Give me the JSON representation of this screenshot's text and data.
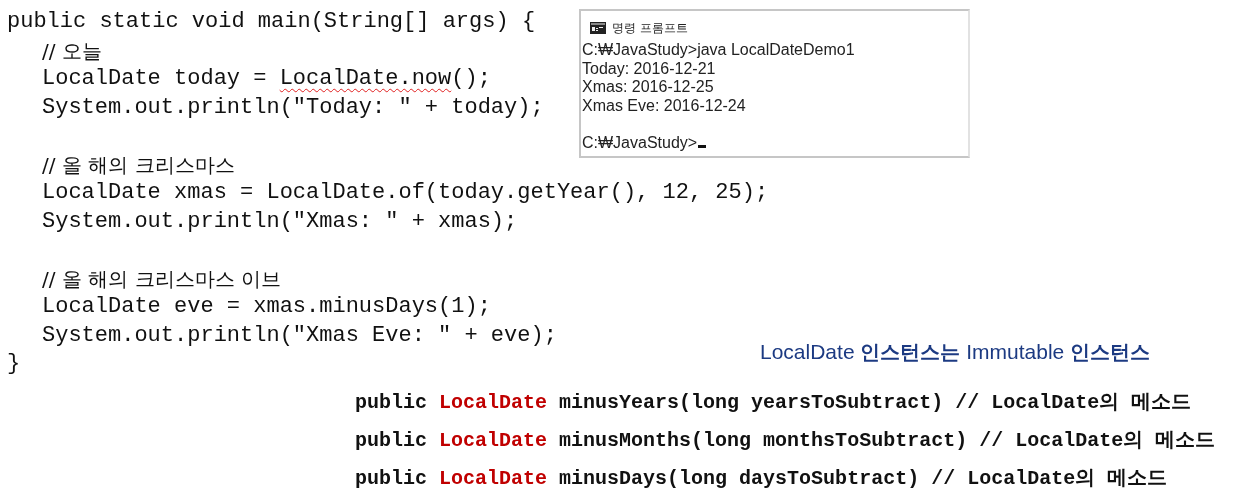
{
  "code": {
    "header": "public static void main(String[] args) {",
    "body": [
      {
        "kind": "comment",
        "text": "// 오늘"
      },
      {
        "kind": "flagged_statement",
        "text": "LocalDate today = ",
        "misspelled_text": "LocalDate.now",
        "text_after": "();"
      },
      {
        "kind": "statement",
        "text": "System.out.println(\"Today: \" + today);"
      },
      {
        "kind": "blank"
      },
      {
        "kind": "comment",
        "text": "// 올 해의 크리스마스"
      },
      {
        "kind": "statement",
        "text": "LocalDate xmas = LocalDate.of(today.getYear(), 12, 25);"
      },
      {
        "kind": "statement",
        "text": "System.out.println(\"Xmas: \" + xmas);"
      },
      {
        "kind": "blank"
      },
      {
        "kind": "comment",
        "text": "// 올 해의 크리스마스 이브"
      },
      {
        "kind": "statement",
        "text": "LocalDate eve = xmas.minusDays(1);"
      },
      {
        "kind": "statement",
        "text": "System.out.println(\"Xmas Eve: \" + eve);"
      }
    ],
    "footer": "}"
  },
  "console": {
    "title": "명령 프롬프트",
    "lines": [
      {
        "kind": "text",
        "text": "C:₩JavaStudy>java LocalDateDemo1"
      },
      {
        "kind": "text",
        "text": "Today: 2016-12-21"
      },
      {
        "kind": "text",
        "text": "Xmas: 2016-12-25"
      },
      {
        "kind": "text",
        "text": "Xmas Eve: 2016-12-24"
      },
      {
        "kind": "blank"
      },
      {
        "kind": "prompt",
        "text": "C:₩JavaStudy>"
      }
    ]
  },
  "caption": "LocalDate **인스턴스는** Immutable **인스턴스**",
  "methods": [
    {
      "modifier": "public",
      "return_type": "LocalDate",
      "signature": "minusYears(long yearsToSubtract) // LocalDate의 메소드"
    },
    {
      "modifier": "public",
      "return_type": "LocalDate",
      "signature": "minusMonths(long monthsToSubtract) // LocalDate의 메소드"
    },
    {
      "modifier": "public",
      "return_type": "LocalDate",
      "signature": "minusDays(long daysToSubtract) // LocalDate의 메소드"
    }
  ]
}
